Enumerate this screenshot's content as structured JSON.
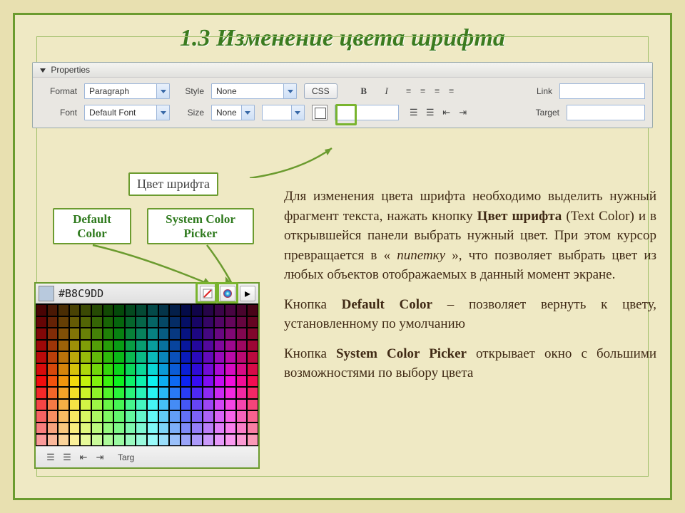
{
  "slide": {
    "title": "1.3  Изменение цвета шрифта"
  },
  "properties": {
    "panel_label": "Properties",
    "row1": {
      "format_label": "Format",
      "format_value": "Paragraph",
      "style_label": "Style",
      "style_value": "None",
      "css_button": "CSS",
      "bold": "B",
      "italic": "I",
      "link_label": "Link"
    },
    "row2": {
      "font_label": "Font",
      "font_value": "Default Font",
      "size_label": "Size",
      "size_value": "None",
      "target_label": "Target"
    }
  },
  "callouts": {
    "text_color": "Цвет шрифта",
    "default_color": "Default Color",
    "system_picker": "System Color Picker"
  },
  "picker": {
    "hex": "#B8C9DD",
    "bottom_targ": "Targ"
  },
  "body": {
    "p1_a": "Для изменения цвета шрифта необходимо выделить нужный фрагмент текста, нажать кнопку ",
    "p1_b": "Цвет шрифта",
    "p1_c": " (Text Color) и в открывшейся панели выбрать нужный цвет. При этом курсор превращается в «",
    "p1_d": "пипетку",
    "p1_e": "», что позволяет выбрать цвет из любых объектов отображаемых в данный момент экране.",
    "p2_a": "Кнопка ",
    "p2_b": "Default Color",
    "p2_c": " – позволяет вернуть к цвету, установленному по умолчанию",
    "p3_a": "Кнопка ",
    "p3_b": "System Color Picker",
    "p3_c": " открывает окно с большими возможностями по выбору цвета"
  }
}
